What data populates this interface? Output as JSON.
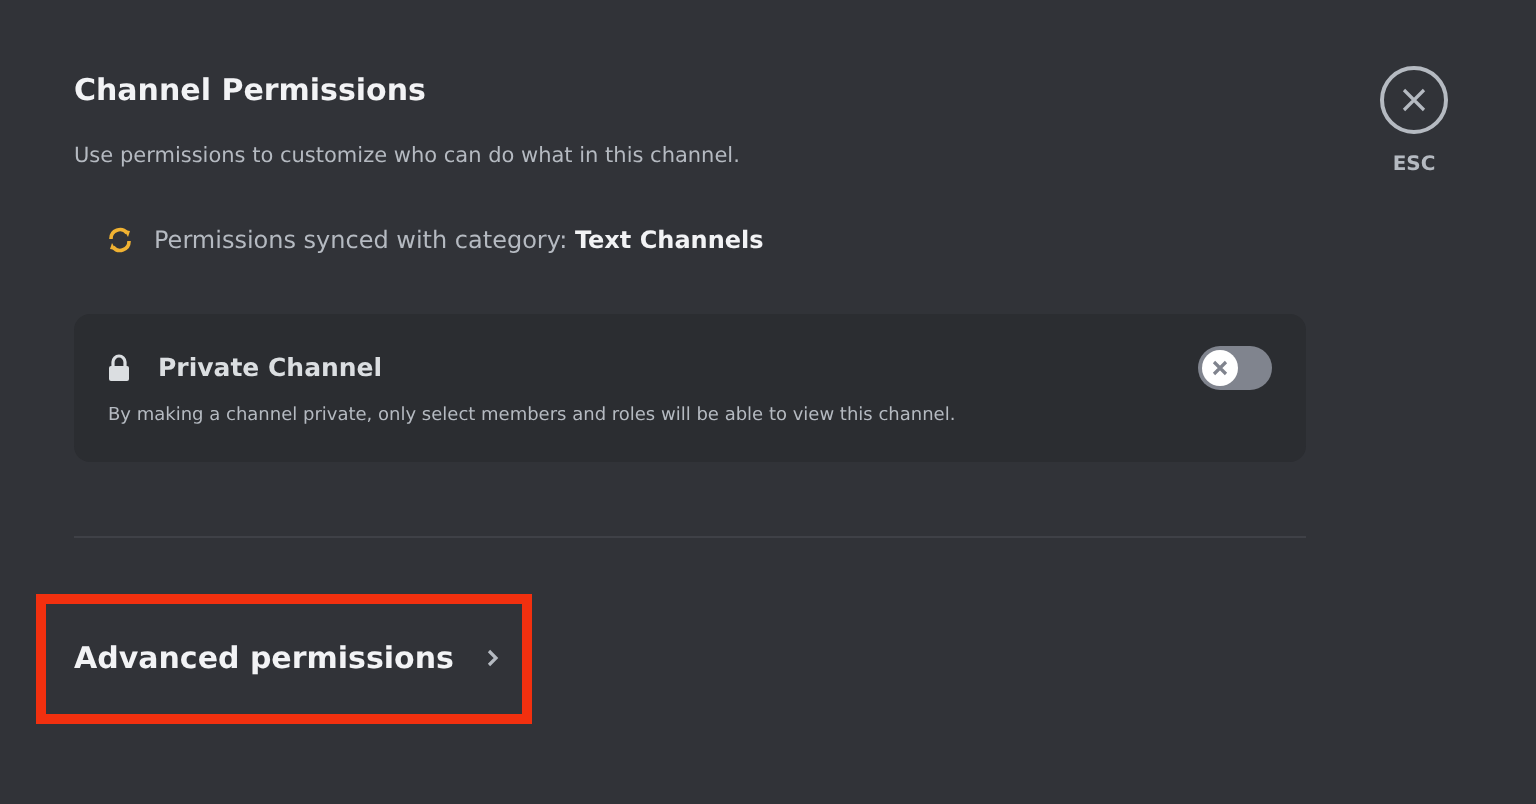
{
  "header": {
    "title": "Channel Permissions",
    "subtitle": "Use permissions to customize who can do what in this channel."
  },
  "close": {
    "label": "ESC"
  },
  "sync_notice": {
    "text": "Permissions synced with category: **Text Channels**"
  },
  "private_channel": {
    "title": "Private Channel",
    "description": "By making a channel private, only select members and roles will be able to view this channel.",
    "on": false
  },
  "advanced_permissions": {
    "label": "Advanced permissions",
    "highlighted": true
  }
}
